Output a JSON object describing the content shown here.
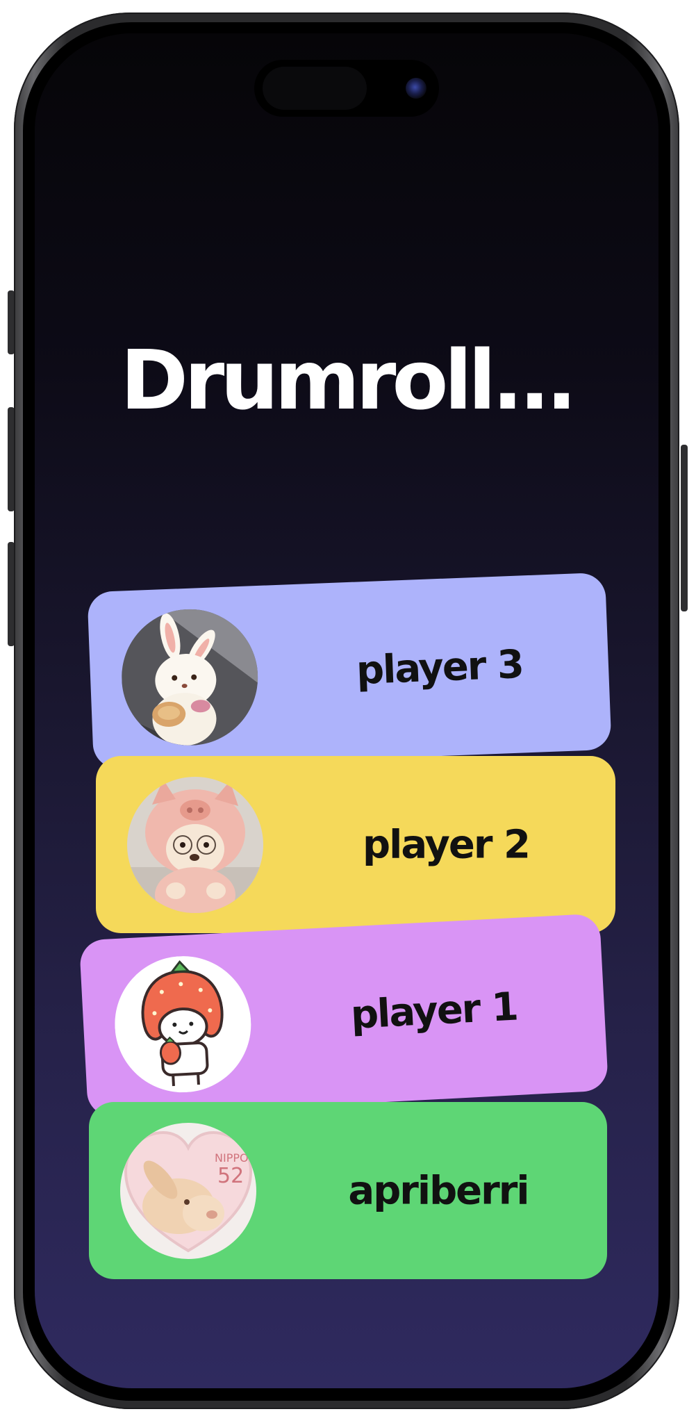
{
  "screen": {
    "title": "Drumroll..."
  },
  "players": [
    {
      "name": "player 3",
      "avatar": "bunny-plush-avatar",
      "card_color": "#adb3fb"
    },
    {
      "name": "player 2",
      "avatar": "piggy-hood-bear-avatar",
      "card_color": "#f5d95a"
    },
    {
      "name": "player 1",
      "avatar": "strawberry-hood-sticker-avatar",
      "card_color": "#d994f5"
    },
    {
      "name": "apriberri",
      "avatar": "bunny-stamp-avatar",
      "card_color": "#5ed675"
    }
  ],
  "avatar_stamp": {
    "country": "NIPPON",
    "value": "52"
  }
}
